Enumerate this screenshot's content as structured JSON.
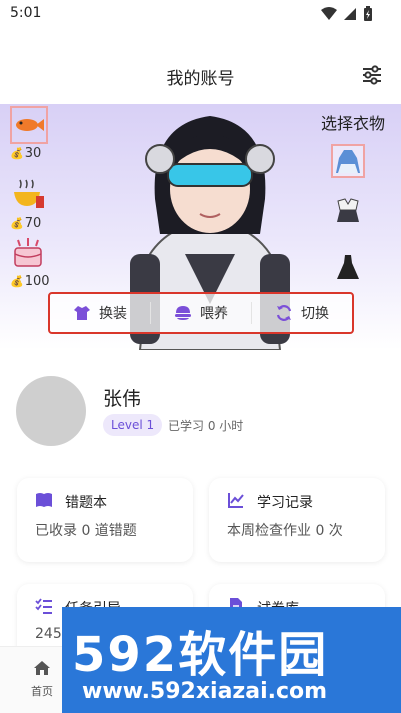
{
  "status": {
    "time": "5:01"
  },
  "header": {
    "title": "我的账号"
  },
  "banner": {
    "foods": [
      {
        "icon": "fish-icon",
        "price": "30"
      },
      {
        "icon": "noodle-bowl-icon",
        "price": "70"
      },
      {
        "icon": "cake-icon",
        "price": "100"
      }
    ],
    "coin_symbol": "💰",
    "choose_label": "选择衣物",
    "clothes": [
      "dress-blue-icon",
      "uniform-icon",
      "black-dress-icon"
    ],
    "actions": [
      {
        "icon": "shirt-icon",
        "label": "换装"
      },
      {
        "icon": "food-bowl-icon",
        "label": "喂养"
      },
      {
        "icon": "refresh-icon",
        "label": "切换"
      }
    ]
  },
  "profile": {
    "name": "张伟",
    "level": "Level 1",
    "study_time": "已学习 0 小时"
  },
  "cards": [
    {
      "icon": "book-icon",
      "title": "错题本",
      "sub": "已收录 0 道错题"
    },
    {
      "icon": "chart-icon",
      "title": "学习记录",
      "sub": "本周检查作业 0 次"
    },
    {
      "icon": "checklist-icon",
      "title": "任务引导",
      "sub": "245"
    },
    {
      "icon": "document-icon",
      "title": "试卷库",
      "sub": ""
    }
  ],
  "nav": {
    "home_label": "首页"
  },
  "watermark": {
    "big": "592软件园",
    "small": "www.592xiazai.com"
  },
  "colors": {
    "accent": "#6b4fd8",
    "highlight_border": "#d9362b",
    "watermark_bg": "#2a77d8"
  }
}
